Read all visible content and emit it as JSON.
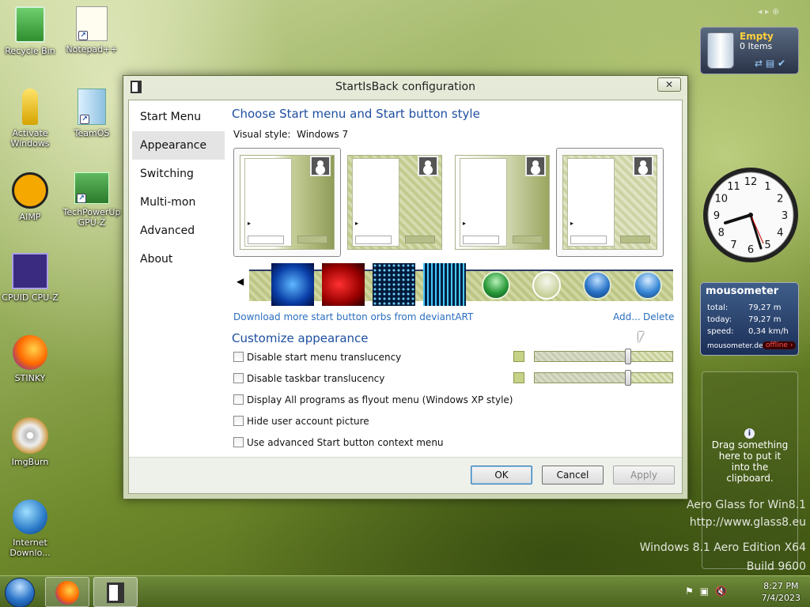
{
  "desktop": {
    "icons": [
      {
        "label": "Recycle Bin"
      },
      {
        "label": "Notepad++"
      },
      {
        "label": "Activate Windows"
      },
      {
        "label": "TeamOS"
      },
      {
        "label": "AIMP"
      },
      {
        "label": "TechPowerUp GPU-Z"
      },
      {
        "label": "CPUID CPU-Z"
      },
      {
        "label": "STINKY"
      },
      {
        "label": "ImgBurn"
      },
      {
        "label": "Internet Downlo..."
      }
    ]
  },
  "window": {
    "title": "StartIsBack configuration",
    "close_label": "✕",
    "sidebar": [
      "Start Menu",
      "Appearance",
      "Switching",
      "Multi-mon",
      "Advanced",
      "About"
    ],
    "heading": "Choose Start menu and Start button style",
    "visual_style_label": "Visual style:",
    "visual_style_value": "Windows 7",
    "deviantart_link": "Download more start button orbs from deviantART",
    "add_link": "Add...",
    "delete_link": "Delete",
    "customize_heading": "Customize appearance",
    "options": [
      "Disable start menu translucency",
      "Disable taskbar translucency",
      "Display All programs as flyout menu (Windows XP style)",
      "Hide user account picture",
      "Use advanced Start button context menu"
    ],
    "sliders": [
      0.67,
      0.67
    ],
    "buttons": {
      "ok": "OK",
      "cancel": "Cancel",
      "apply": "Apply"
    }
  },
  "gadgets": {
    "recycle": {
      "title": "Empty",
      "count": "0 Items"
    },
    "mousometer": {
      "title": "mousometer",
      "rows": [
        {
          "label": "total:",
          "value": "79,27 m"
        },
        {
          "label": "today:",
          "value": "79,27 m"
        },
        {
          "label": "speed:",
          "value": "0,34 km/h"
        }
      ],
      "site": "mousometer.de",
      "status": "offline"
    },
    "clipboard": {
      "info": "i",
      "text": "Drag something here to put it into the clipboard."
    }
  },
  "watermark": {
    "line1": "Aero Glass for Win8.1",
    "line2": "http://www.glass8.eu",
    "line3": "Windows 8.1 Aero Edition X64",
    "line4": "Build 9600"
  },
  "taskbar": {
    "time": "8:27 PM",
    "date": "7/4/2023"
  },
  "clock": {
    "numbers": [
      "12",
      "1",
      "2",
      "3",
      "4",
      "5",
      "6",
      "7",
      "8",
      "9",
      "10",
      "11"
    ]
  }
}
